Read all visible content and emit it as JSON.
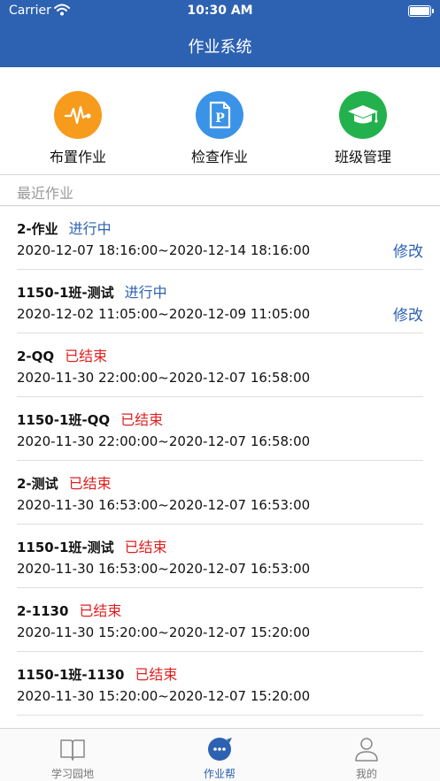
{
  "status_bar": {
    "carrier": "Carrier",
    "time": "10:30 AM"
  },
  "nav": {
    "title": "作业系统"
  },
  "quick_actions": [
    {
      "label": "布置作业",
      "icon": "heartbeat-icon",
      "color": "#f79b1c"
    },
    {
      "label": "检查作业",
      "icon": "document-p-icon",
      "color": "#3a93e6"
    },
    {
      "label": "班级管理",
      "icon": "graduation-cap-icon",
      "color": "#22b14c"
    }
  ],
  "section": {
    "title": "最近作业"
  },
  "colors": {
    "brand": "#2d62b2",
    "ongoing": "#2d62b2",
    "ended": "#e02020"
  },
  "homework": [
    {
      "title": "2-作业",
      "status": "进行中",
      "state": "ongoing",
      "range": "2020-12-07 18:16:00~2020-12-14 18:16:00",
      "edit": "修改"
    },
    {
      "title": "1150-1班-测试",
      "status": "进行中",
      "state": "ongoing",
      "range": "2020-12-02 11:05:00~2020-12-09 11:05:00",
      "edit": "修改"
    },
    {
      "title": "2-QQ",
      "status": "已结束",
      "state": "ended",
      "range": "2020-11-30 22:00:00~2020-12-07 16:58:00"
    },
    {
      "title": "1150-1班-QQ",
      "status": "已结束",
      "state": "ended",
      "range": "2020-11-30 22:00:00~2020-12-07 16:58:00"
    },
    {
      "title": "2-测试",
      "status": "已结束",
      "state": "ended",
      "range": "2020-11-30 16:53:00~2020-12-07 16:53:00"
    },
    {
      "title": "1150-1班-测试",
      "status": "已结束",
      "state": "ended",
      "range": "2020-11-30 16:53:00~2020-12-07 16:53:00"
    },
    {
      "title": "2-1130",
      "status": "已结束",
      "state": "ended",
      "range": "2020-11-30 15:20:00~2020-12-07 15:20:00"
    },
    {
      "title": "1150-1班-1130",
      "status": "已结束",
      "state": "ended",
      "range": "2020-11-30 15:20:00~2020-12-07 15:20:00"
    }
  ],
  "tabs": [
    {
      "label": "学习园地",
      "icon": "book-icon",
      "active": false
    },
    {
      "label": "作业帮",
      "icon": "chat-bubble-icon",
      "active": true
    },
    {
      "label": "我的",
      "icon": "person-icon",
      "active": false
    }
  ]
}
